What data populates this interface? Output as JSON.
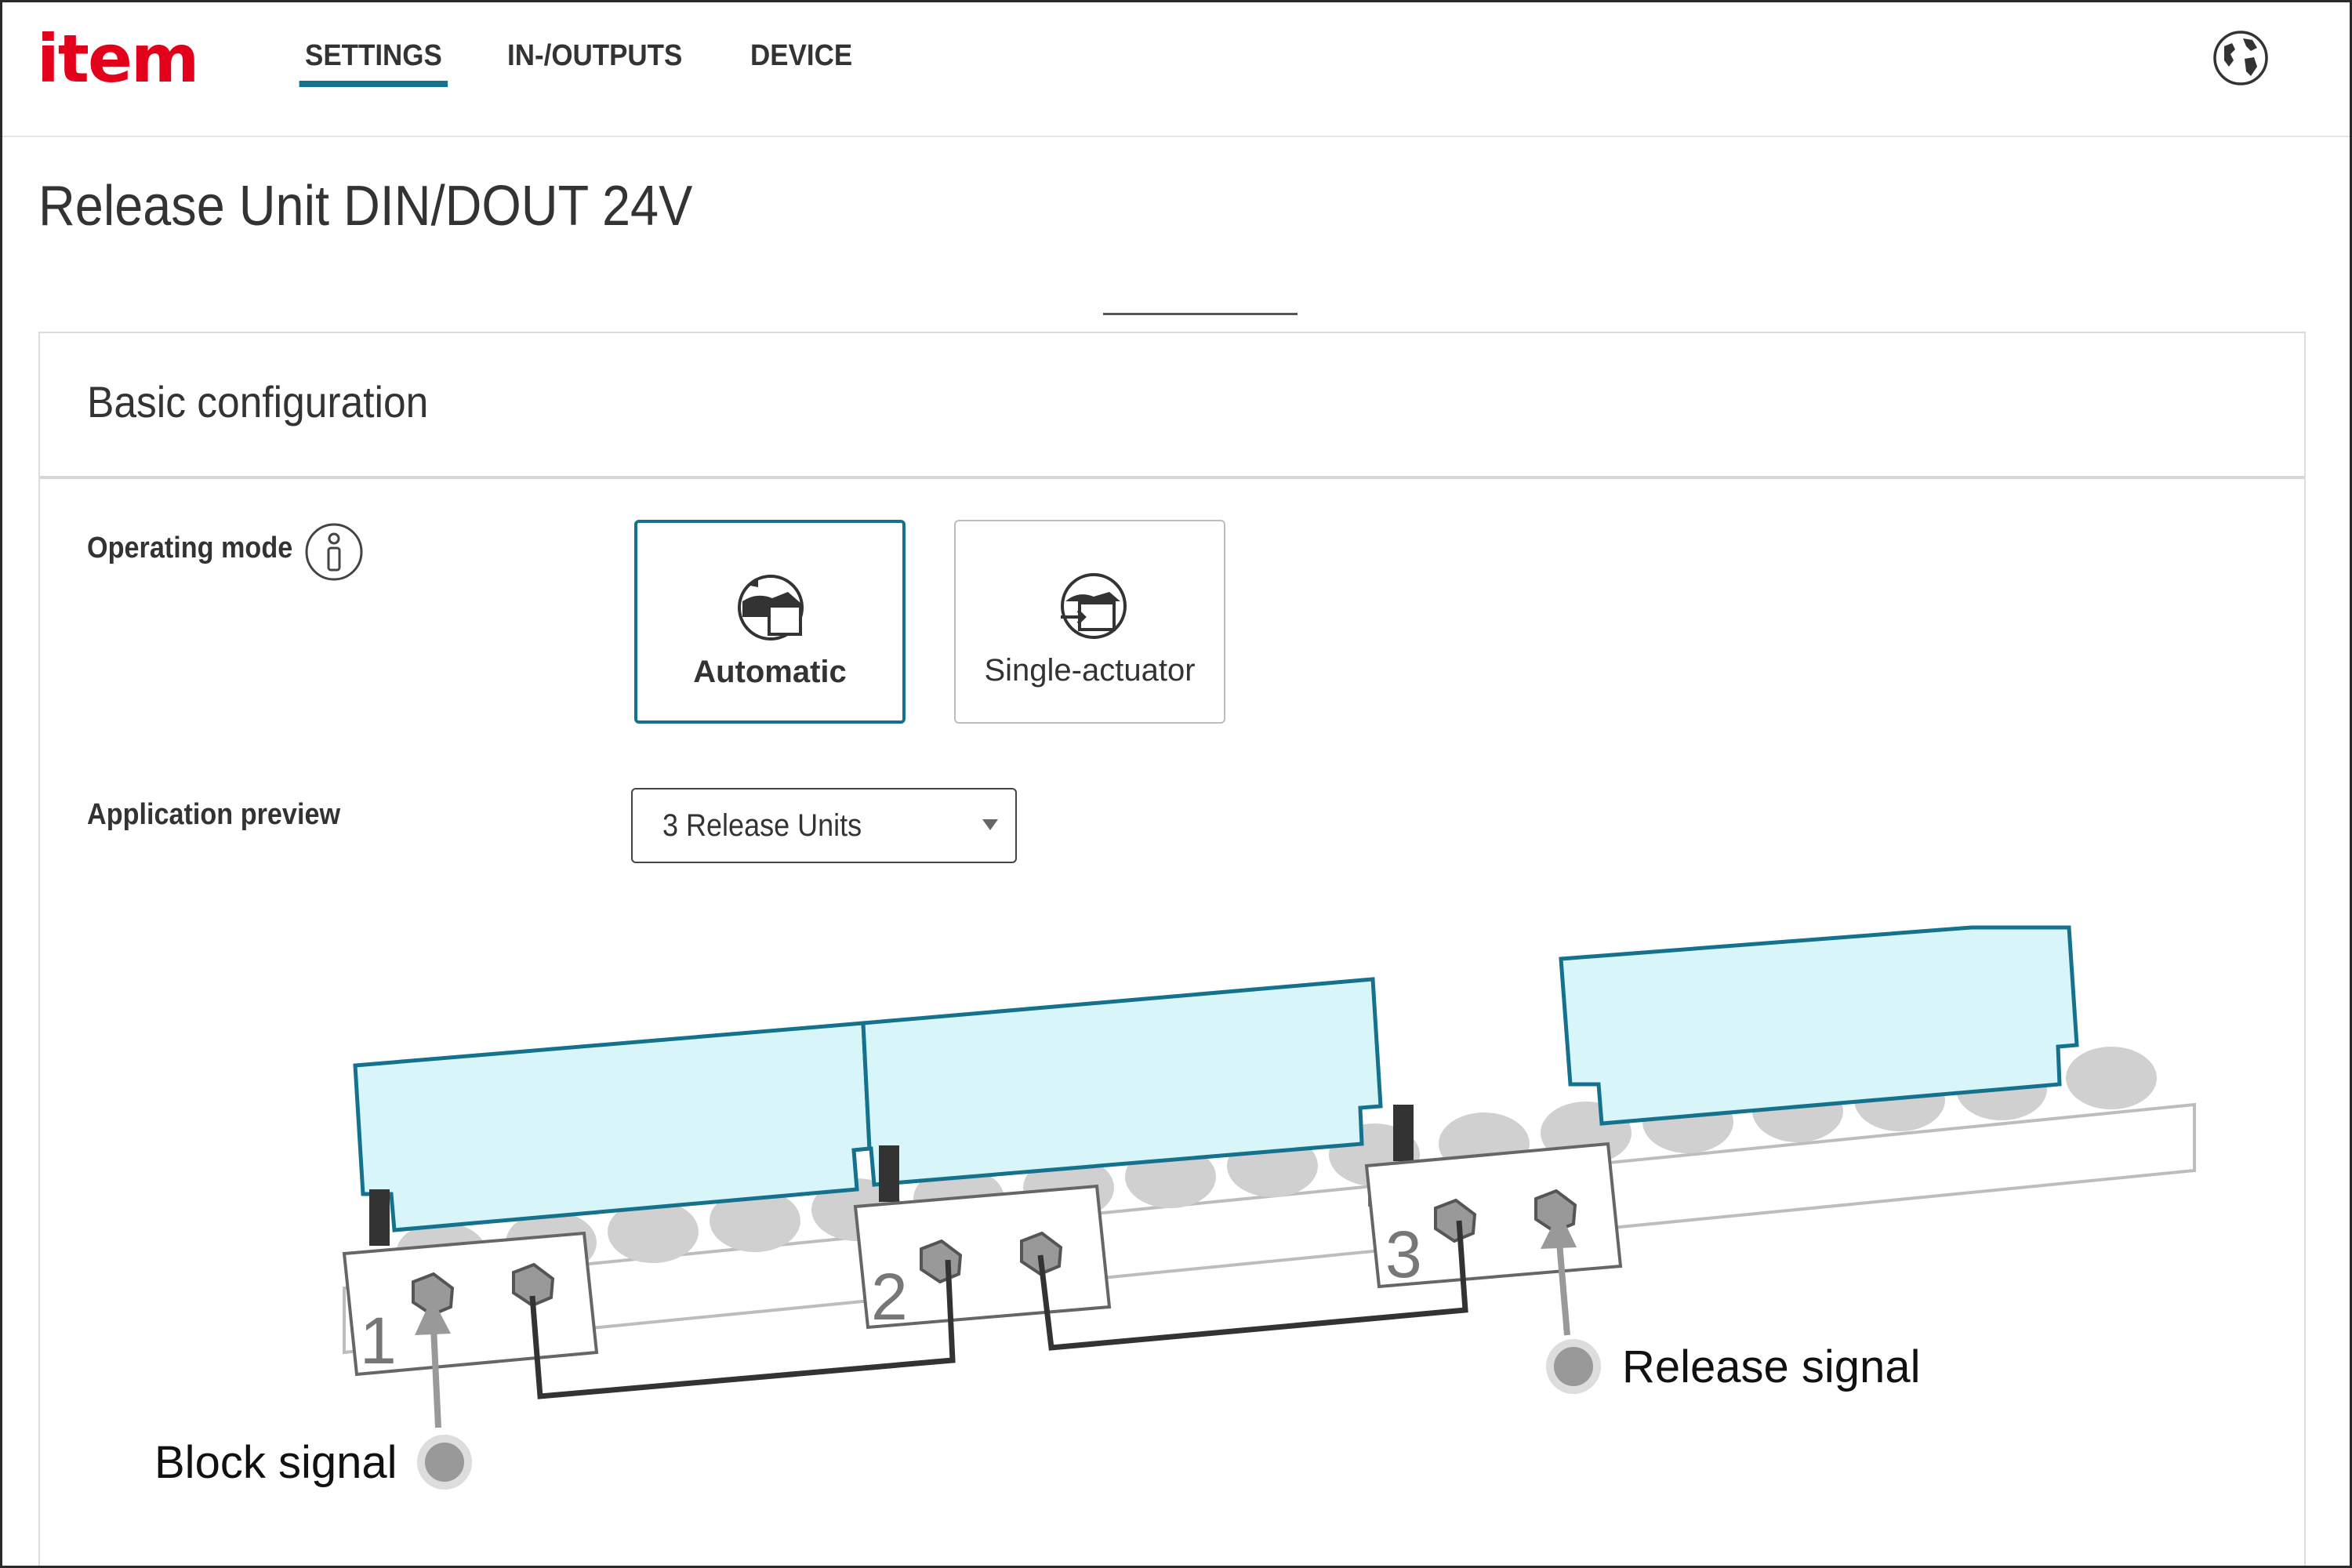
{
  "header": {
    "logo": "item",
    "tabs": [
      {
        "label": "SETTINGS",
        "active": true
      },
      {
        "label": "IN-/OUTPUTS",
        "active": false
      },
      {
        "label": "DEVICE",
        "active": false
      }
    ],
    "language_icon": "globe-icon"
  },
  "page": {
    "title": "Release Unit DIN/DOUT 24V"
  },
  "card": {
    "title": "Basic configuration",
    "operating_mode": {
      "label": "Operating mode",
      "info_icon": "info-icon",
      "options": [
        {
          "label": "Automatic",
          "icon": "automatic-mode-icon",
          "selected": true
        },
        {
          "label": "Single-actuator",
          "icon": "single-actuator-icon",
          "selected": false
        }
      ]
    },
    "application_preview": {
      "label": "Application preview",
      "selected": "3 Release Units",
      "unit_numbers": [
        "1",
        "2",
        "3"
      ],
      "block_signal_label": "Block signal",
      "release_signal_label": "Release signal"
    }
  },
  "colors": {
    "brand_red": "#e3001b",
    "accent_teal": "#14728d",
    "carrier_fill": "#d8f5f9"
  }
}
